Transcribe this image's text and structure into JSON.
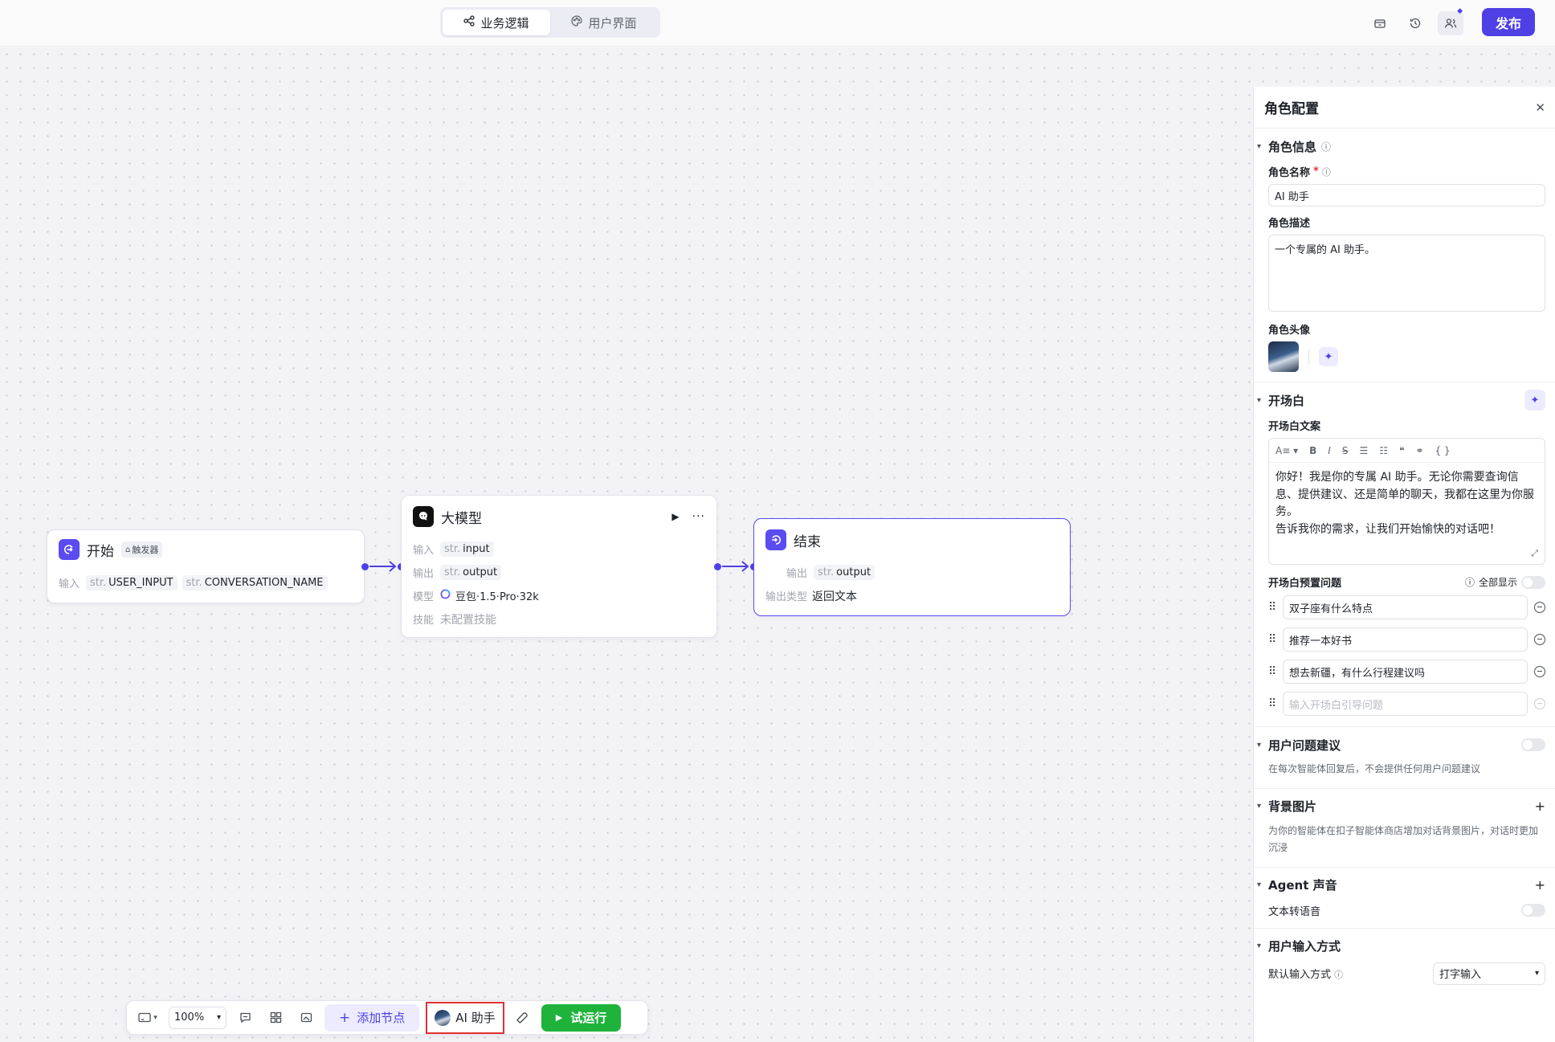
{
  "topbar": {
    "tabs": [
      {
        "label": "业务逻辑",
        "icon": "flow-icon",
        "active": true
      },
      {
        "label": "用户界面",
        "icon": "palette-icon",
        "active": false
      }
    ],
    "publish_label": "发布",
    "accent": "#4e40e5"
  },
  "nodes": {
    "start": {
      "title": "开始",
      "tag": "触发器",
      "input_label": "输入",
      "params": [
        {
          "type": "str.",
          "name": "USER_INPUT"
        },
        {
          "type": "str.",
          "name": "CONVERSATION_NAME"
        }
      ]
    },
    "llm": {
      "title": "大模型",
      "input_label": "输入",
      "input_type": "str.",
      "input_name": "input",
      "output_label": "输出",
      "output_type": "str.",
      "output_name": "output",
      "model_label": "模型",
      "model_name": "豆包·1.5·Pro·32k",
      "skill_label": "技能",
      "skill_value": "未配置技能"
    },
    "end": {
      "title": "结束",
      "output_label": "输出",
      "output_type": "str.",
      "output_name": "output",
      "output_kind_label": "输出类型",
      "output_kind_value": "返回文本"
    }
  },
  "panel": {
    "title": "角色配置",
    "role_info": {
      "heading": "角色信息",
      "name_label": "角色名称",
      "name_value": "AI 助手",
      "desc_label": "角色描述",
      "desc_value": "一个专属的 AI 助手。",
      "avatar_label": "角色头像"
    },
    "opening": {
      "heading": "开场白",
      "text_label": "开场白文案",
      "text_line1": "你好！我是你的专属 AI 助手。无论你需要查询信息、提供建议、还是简单的聊天，我都在这里为你服务。",
      "text_line2": "告诉我你的需求，让我们开始愉快的对话吧！",
      "preset_label": "开场白预置问题",
      "show_all_label": "全部显示",
      "questions": [
        "双子座有什么特点",
        "推荐一本好书",
        "想去新疆，有什么行程建议吗"
      ],
      "new_question_placeholder": "输入开场白引导问题"
    },
    "suggest": {
      "heading": "用户问题建议",
      "desc": "在每次智能体回复后，不会提供任何用户问题建议"
    },
    "background": {
      "heading": "背景图片",
      "desc": "为你的智能体在扣子智能体商店增加对话背景图片，对话时更加沉浸"
    },
    "voice": {
      "heading": "Agent 声音",
      "tts_label": "文本转语音"
    },
    "input_mode": {
      "heading": "用户输入方式",
      "default_label": "默认输入方式",
      "default_value": "打字输入"
    }
  },
  "bottombar": {
    "zoom": "100%",
    "add_node_label": "添加节点",
    "agent_label": "AI 助手",
    "run_label": "试运行"
  }
}
